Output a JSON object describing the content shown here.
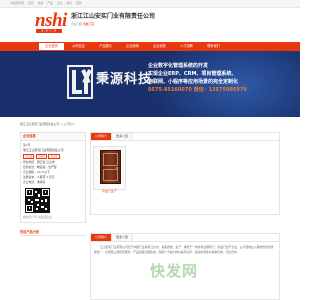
{
  "topbar": {
    "links": [
      "中国安防网",
      "首页",
      "供求",
      "产品",
      "企业",
      "资讯",
      "招聘"
    ]
  },
  "header": {
    "logo_text": "nshi",
    "logo_sub": "安 实 门 业",
    "company_name": "浙江江山安实门业有限责任公司",
    "meta_prefix": "企业门店",
    "meta_fav": "收藏门店",
    "meta_suffix": "公"
  },
  "nav": {
    "items": [
      "企业首页",
      "公司信息",
      "产品展示",
      "企业新闻",
      "企业资质",
      "人才招聘",
      "联系我们"
    ]
  },
  "banner": {
    "brand": "秉源科技",
    "lines": [
      "企业数字化管理系统的开发",
      "实现企业ERP、CRM、项目管理系统、",
      "物联网、小程序等应用场景的完全定制化",
      "0575-85160070 微信：13575095979"
    ]
  },
  "breadcrumb": {
    "home": "浙江江山安实门业有限责任公司",
    "sep": " > ",
    "current": "公司简介"
  },
  "sidebar": {
    "title": "企业信息",
    "rank_label": "第",
    "rank_hl": "1",
    "rank_suffix": "年",
    "company": "浙江江山安实门业有限责任公司",
    "tags": [
      "已认证",
      "已核实",
      "未认证"
    ],
    "rows": [
      {
        "label": "所在地区：",
        "value": "浙江省 江山市"
      },
      {
        "label": "经营模式：",
        "value": "制造商，生产型"
      },
      {
        "label": "企业规模：",
        "value": "10 人以下"
      },
      {
        "label": "注册资本：",
        "value": "人民币 1 亿元"
      },
      {
        "label": "企业电话：",
        "value": "未填写"
      }
    ],
    "qr_caption": "微信扫一扫 关注该企业",
    "cat_title": "供应产品分类"
  },
  "main": {
    "tabs": [
      "公司简介",
      "更多介绍"
    ],
    "product_name": "防盗门生产"
  },
  "intro": {
    "tabs": [
      "公司简介",
      "更多介绍"
    ],
    "text": "江山安实门业有限公司位于中国门业基地江山市，是集研发、生产、销售于一体的专业钢质门、防盗门生产企业，公司自成立以来始终坚持质量第一、信誉至上的经营理念，产品远销全国各地，深受广大客户的信赖与好评，欢迎新老客户来电咨询，洽谈合作。"
  },
  "watermark": "快发网",
  "colors": {
    "brand": "#e8380d",
    "banner": "#19306c",
    "phone": "#f07a2c"
  }
}
